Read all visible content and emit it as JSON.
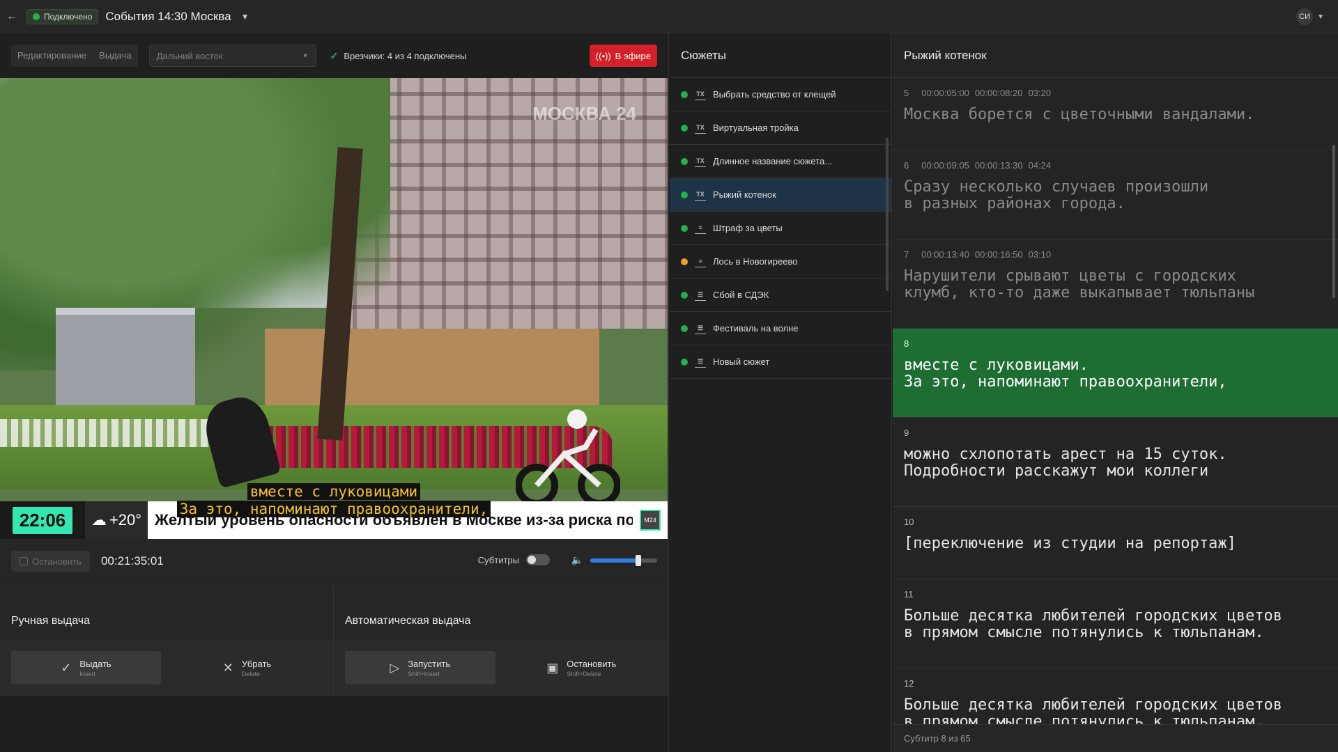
{
  "header": {
    "connection_status": "Подключено",
    "event_title": "События 14:30 Москва",
    "user_initials": "СИ"
  },
  "toolbar": {
    "mode_edit": "Редактирование",
    "mode_output": "Выдача",
    "region_select": "Дальний восток",
    "ties_status": "Врезчики: 4 из 4 подключены",
    "on_air_label": "В эфире"
  },
  "video": {
    "watermark": "МОСКВА 24",
    "ticker_time": "22:06",
    "ticker_weather": "+20°",
    "ticker_text": "Желтый уровень опасности объявлен в Москве из-за риска пожаров",
    "ticker_logo": "M24",
    "subtitle_line1": "вместе с луковицами",
    "subtitle_line2": "За это, напоминают правоохранители,"
  },
  "player": {
    "stop_label": "Остановить",
    "timecode": "00:21:35:01",
    "subtitles_label": "Субтитры",
    "volume_level": 0.72
  },
  "manual_output": {
    "title": "Ручная выдача",
    "issue_label": "Выдать",
    "issue_shortcut": "Insert",
    "remove_label": "Убрать",
    "remove_shortcut": "Delete"
  },
  "auto_output": {
    "title": "Автоматическая выдача",
    "start_label": "Запустить",
    "start_shortcut": "Shift+Insert",
    "stop_label": "Остановить",
    "stop_shortcut": "Shift+Delete"
  },
  "stories": {
    "title": "Сюжеты",
    "items": [
      {
        "label": "Выбрать средство от клещей",
        "status": "green",
        "icon": "tx-icon"
      },
      {
        "label": "Виртуальная тройка",
        "status": "green",
        "icon": "tx-icon"
      },
      {
        "label": "Длинное название сюжета...",
        "status": "green",
        "icon": "tx-icon"
      },
      {
        "label": "Рыжий котенок",
        "status": "green",
        "icon": "tx-icon",
        "active": true
      },
      {
        "label": "Штраф за цветы",
        "status": "green",
        "icon": "text-lines-icon"
      },
      {
        "label": "Лось в Новогиреево",
        "status": "orange",
        "icon": "text-lines-icon"
      },
      {
        "label": "Сбой в СДЭК",
        "status": "green",
        "icon": "list-icon"
      },
      {
        "label": "Фестиваль на волне",
        "status": "green",
        "icon": "list-icon"
      },
      {
        "label": "Новый сюжет",
        "status": "green",
        "icon": "list-icon"
      }
    ]
  },
  "subtitles_panel": {
    "title": "Рыжий котенок",
    "footer": "Субтитр 8 из 65",
    "items": [
      {
        "num": "5",
        "in": "00:00:05:00",
        "out": "00:00:08:20",
        "dur": "03:20",
        "text": "Москва борется с цветочными вандалами.",
        "state": "past"
      },
      {
        "num": "6",
        "in": "00:00:09:05",
        "out": "00:00:13:30",
        "dur": "04:24",
        "text": "Сразу несколько случаев произошли\nв разных районах города.",
        "state": "past"
      },
      {
        "num": "7",
        "in": "00:00:13:40",
        "out": "00:00:16:50",
        "dur": "03:10",
        "text": "Нарушители срывают цветы с городских\nклумб, кто-то даже выкапывает тюльпаны",
        "state": "past"
      },
      {
        "num": "8",
        "in": "",
        "out": "",
        "dur": "",
        "text": "вместе с луковицами.\nЗа это, напоминают правоохранители,",
        "state": "current"
      },
      {
        "num": "9",
        "in": "",
        "out": "",
        "dur": "",
        "text": "можно схлопотать арест на 15 суток.\nПодробности расскажут мои коллеги",
        "state": "future"
      },
      {
        "num": "10",
        "in": "",
        "out": "",
        "dur": "",
        "text": "[переключение из студии на репортаж]",
        "state": "future"
      },
      {
        "num": "11",
        "in": "",
        "out": "",
        "dur": "",
        "text": "Больше десятка любителей городских цветов\nв прямом смысле потянулись к тюльпанам.",
        "state": "future"
      },
      {
        "num": "12",
        "in": "",
        "out": "",
        "dur": "",
        "text": "Больше десятка любителей городских цветов\nв прямом смысле потянулись к тюльпанам.",
        "state": "future"
      }
    ]
  }
}
